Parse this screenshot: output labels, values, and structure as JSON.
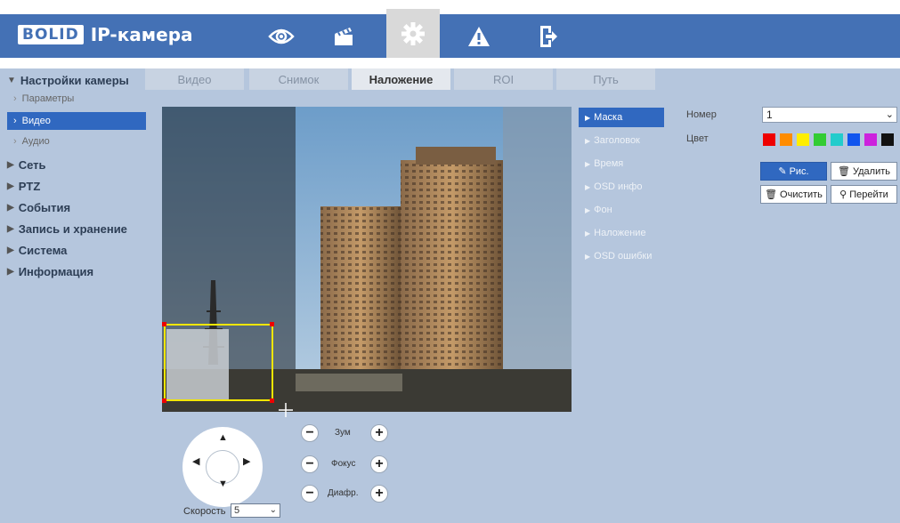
{
  "header": {
    "logo": "BOLID",
    "product": "IP-камера",
    "nav_icons": [
      "eye-icon",
      "clapper-icon",
      "gear-icon",
      "warning-icon",
      "exit-icon"
    ],
    "active_nav": "gear-icon",
    "brand_color": "#4471b5"
  },
  "sidebar": {
    "camera_settings": "Настройки камеры",
    "sub": {
      "params": "Параметры",
      "video": "Видео",
      "audio": "Аудио"
    },
    "network": "Сеть",
    "ptz": "PTZ",
    "events": "События",
    "storage": "Запись и хранение",
    "system": "Система",
    "info": "Информация"
  },
  "tabs": {
    "video": "Видео",
    "snapshot": "Снимок",
    "overlay": "Наложение",
    "roi": "ROI",
    "path": "Путь"
  },
  "overlay_menu": {
    "mask": "Маска",
    "title": "Заголовок",
    "time": "Время",
    "osd_info": "OSD инфо",
    "background": "Фон",
    "overlay": "Наложение",
    "osd_errors": "OSD ошибки"
  },
  "mask_panel": {
    "number_label": "Номер",
    "number_value": "1",
    "color_label": "Цвет",
    "colors": [
      "#ee0000",
      "#ff8c00",
      "#ffee00",
      "#33cc33",
      "#22cccc",
      "#1155ee",
      "#cc22dd",
      "#111111"
    ],
    "draw_btn": "Рис.",
    "delete_btn": "Удалить",
    "clear_btn": "Очистить",
    "goto_btn": "Перейти"
  },
  "ptz_controls": {
    "zoom": "Зум",
    "focus": "Фокус",
    "iris": "Диафр.",
    "minus": "−",
    "plus": "+",
    "speed_label": "Скорость",
    "speed_value": "5"
  }
}
